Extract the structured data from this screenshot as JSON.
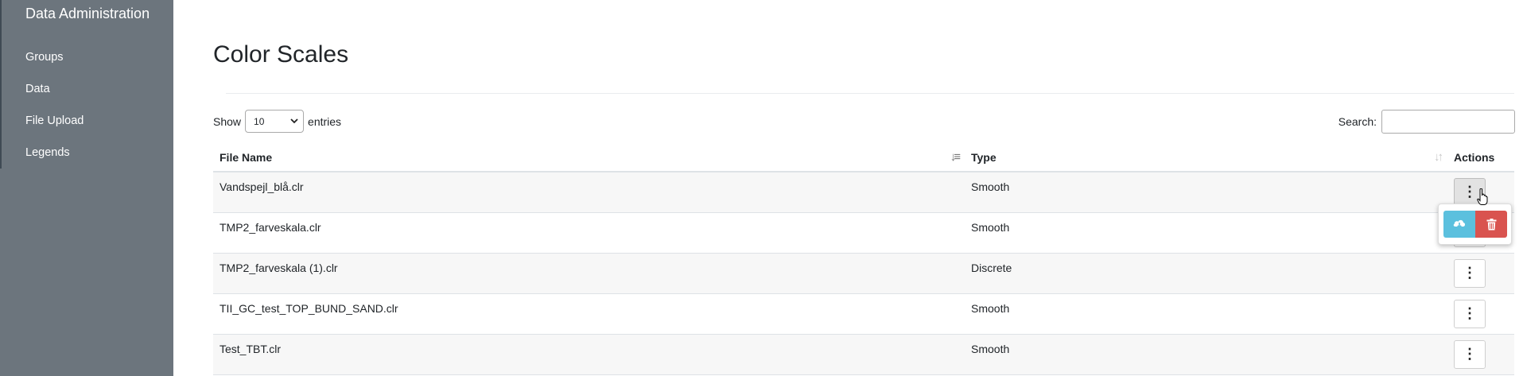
{
  "sidebar": {
    "title": "Data Administration",
    "items": [
      {
        "label": "Groups"
      },
      {
        "label": "Data"
      },
      {
        "label": "File Upload"
      },
      {
        "label": "Legends"
      }
    ]
  },
  "page": {
    "title": "Color Scales"
  },
  "length_control": {
    "show_label": "Show",
    "value": "10",
    "entries_label": "entries"
  },
  "search": {
    "label": "Search:",
    "value": ""
  },
  "table": {
    "headers": {
      "file_name": "File Name",
      "type": "Type",
      "actions": "Actions"
    },
    "rows": [
      {
        "file_name": "Vandspejl_blå.clr",
        "type": "Smooth"
      },
      {
        "file_name": "TMP2_farveskala.clr",
        "type": "Smooth"
      },
      {
        "file_name": "TMP2_farveskala (1).clr",
        "type": "Discrete"
      },
      {
        "file_name": "TII_GC_test_TOP_BUND_SAND.clr",
        "type": "Smooth"
      },
      {
        "file_name": "Test_TBT.clr",
        "type": "Smooth"
      }
    ]
  },
  "actions_menu": {
    "open_row_index": 0,
    "buttons": [
      {
        "icon": "cloud-download-icon",
        "color": "#5bc0de"
      },
      {
        "icon": "trash-icon",
        "color": "#d9534f"
      }
    ]
  },
  "colors": {
    "sidebar_bg": "#6c757d",
    "download_btn": "#5bc0de",
    "delete_btn": "#d9534f"
  }
}
